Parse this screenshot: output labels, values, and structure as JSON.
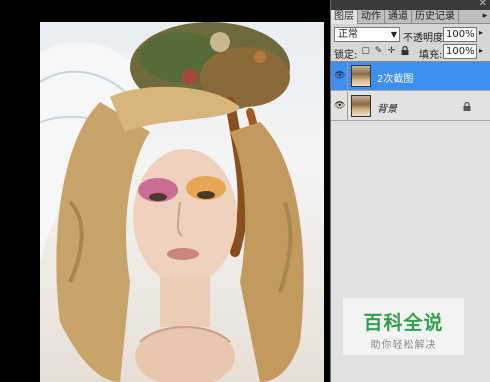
{
  "panel": {
    "tabs": [
      {
        "label": "图层",
        "active": true
      },
      {
        "label": "动作",
        "active": false
      },
      {
        "label": "通道",
        "active": false
      },
      {
        "label": "历史记录",
        "active": false
      }
    ],
    "blend_mode": "正常",
    "opacity_label": "不透明度:",
    "opacity_value": "100%",
    "lock_label": "锁定:",
    "fill_label": "填充:",
    "fill_value": "100%",
    "layers": [
      {
        "name": "2次截图",
        "selected": true,
        "italic": false,
        "locked": false
      },
      {
        "name": "背景",
        "selected": false,
        "italic": true,
        "locked": true
      }
    ]
  },
  "watermark": {
    "title": "百科全说",
    "subtitle": "助你轻松解决"
  },
  "colors": {
    "selection": "#3d8ff0",
    "watermark_green": "#2ea14a",
    "panel_bg": "#d6d6d6"
  }
}
